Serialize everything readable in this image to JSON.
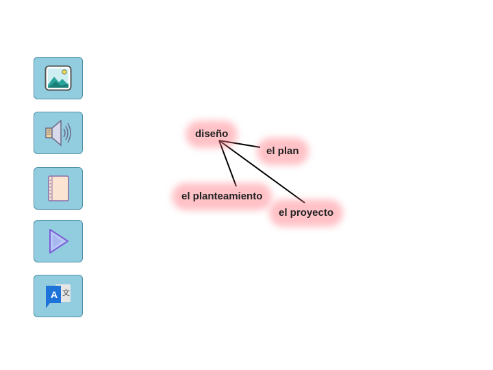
{
  "sidebar": {
    "buttons": [
      {
        "name": "image-button",
        "icon": "image-icon"
      },
      {
        "name": "audio-button",
        "icon": "speaker-icon"
      },
      {
        "name": "book-button",
        "icon": "notebook-icon"
      },
      {
        "name": "play-button",
        "icon": "play-icon"
      },
      {
        "name": "translate-button",
        "icon": "translate-icon"
      }
    ],
    "translate_icon_latin": "A",
    "translate_icon_cjk": "文"
  },
  "word_map": {
    "center": "diseño",
    "synonyms": [
      "el plan",
      "el planteamiento",
      "el proyecto"
    ]
  },
  "colors": {
    "button_bg": "#92cddf",
    "button_border": "#4d8fa6",
    "highlight": "#ff7882",
    "line": "#000000"
  }
}
